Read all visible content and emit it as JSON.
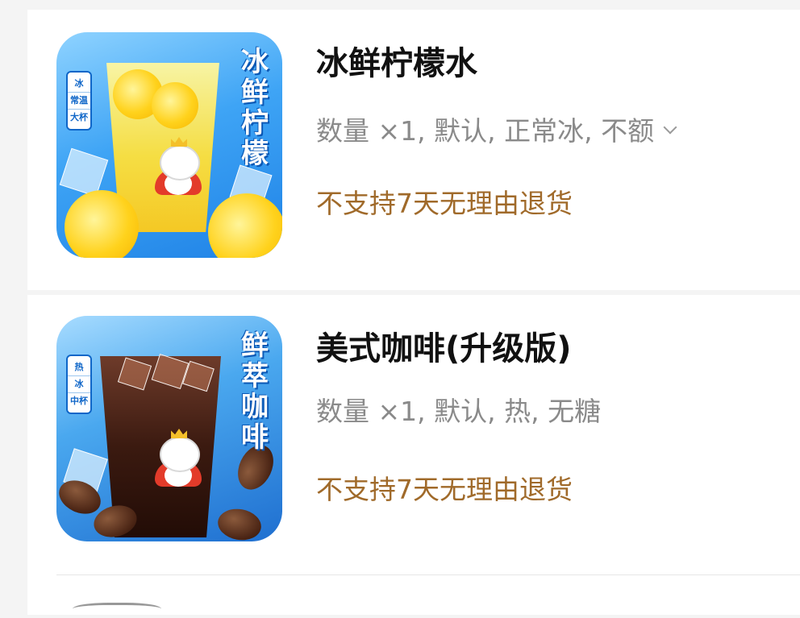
{
  "items": [
    {
      "name": "冰鲜柠檬水",
      "spec": "数量 ×1, 默认, 正常冰, 不额",
      "policy": "不支持7天无理由退货",
      "image": {
        "vertical_title": [
          "冰",
          "鲜",
          "柠",
          "檬"
        ],
        "tags": [
          "冰",
          "常温",
          "大杯"
        ]
      }
    },
    {
      "name": "美式咖啡(升级版)",
      "spec": "数量 ×1, 默认, 热, 无糖",
      "policy": "不支持7天无理由退货",
      "image": {
        "vertical_title": [
          "鲜",
          "萃",
          "咖",
          "啡"
        ],
        "tags": [
          "热",
          "冰",
          "中杯"
        ]
      }
    }
  ],
  "colors": {
    "policy_text": "#a06a2a",
    "spec_text": "#8a8a8a",
    "name_text": "#111111"
  },
  "icons": {
    "expand": "chevron-down-icon"
  }
}
